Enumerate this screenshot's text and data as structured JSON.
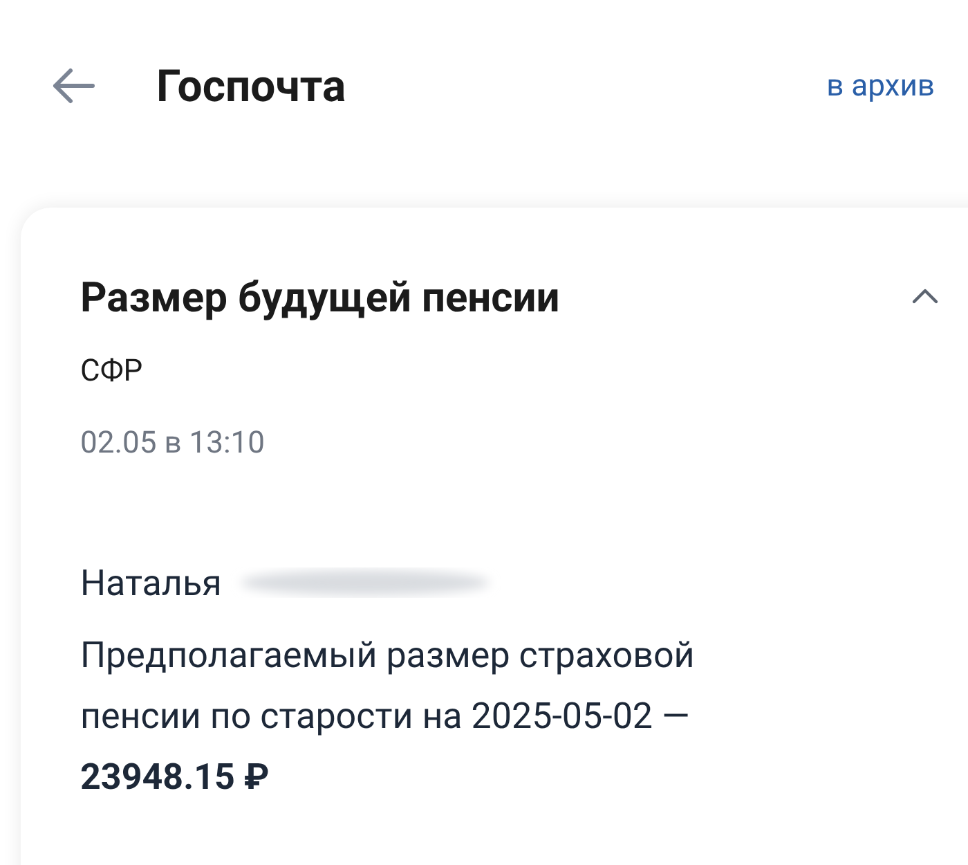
{
  "header": {
    "title": "Госпочта",
    "action": "в архив"
  },
  "message": {
    "title": "Размер будущей пенсии",
    "expanded": true,
    "sender": "СФР",
    "date": "02.05 в 13:10",
    "greeting": "Наталья",
    "body": "Предполагаемый размер страховой пенсии по старости на 2025-05-02 — **23948.15 ₽**"
  }
}
